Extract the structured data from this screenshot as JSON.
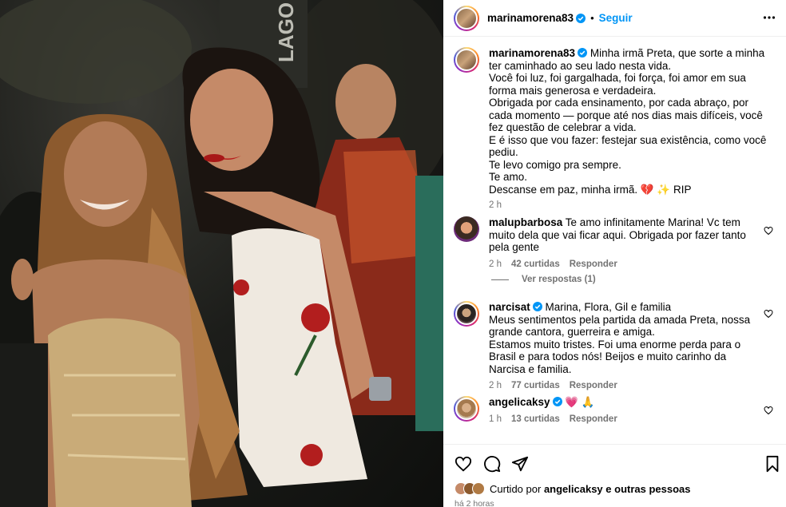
{
  "post": {
    "owner": "marinamorena83",
    "dot": "•",
    "follow_label": "Seguir",
    "caption_lines": [
      "Minha irmã Preta, que sorte a minha ter caminhado ao seu lado nesta vida.",
      "Você foi luz, foi gargalhada, foi força, foi amor em sua forma mais generosa e verdadeira.",
      "Obrigada por cada ensinamento, por cada abraço, por cada momento — porque até nos dias mais difíceis, você fez questão de celebrar a vida.",
      "E é isso que vou fazer: festejar sua existência, como você pediu.",
      "Te levo comigo pra sempre.",
      "Te amo.",
      "Descanse em paz, minha irmã. 💔 ✨ RIP"
    ],
    "caption_time": "2 h"
  },
  "comments": [
    {
      "user": "malupbarbosa",
      "text": "Te amo infinitamente Marina! Vc tem muito dela que vai ficar aqui. Obrigada por fazer tanto pela gente",
      "time": "2 h",
      "likes": "42 curtidas",
      "reply": "Responder",
      "view_replies": "Ver respostas (1)"
    },
    {
      "user": "narcisat",
      "lines": [
        "Marina, Flora, Gil e familia",
        "Meus sentimentos pela partida da amada Preta, nossa grande cantora, guerreira e amiga.",
        "Estamos muito tristes. Foi uma enorme perda para o Brasil e para todos nós! Beijos e muito carinho da Narcisa e familia."
      ],
      "time": "2 h",
      "likes": "77 curtidas",
      "reply": "Responder"
    },
    {
      "user": "angelicaksy",
      "text": "💗 🙏",
      "time": "1 h",
      "likes": "13 curtidas",
      "reply": "Responder"
    }
  ],
  "footer": {
    "liked_prefix": "Curtido por",
    "liked_user": "angelicaksy",
    "liked_suffix": "e outras pessoas",
    "time_ago": "há 2 horas"
  },
  "photo": {
    "sign_text": "LAGO"
  },
  "colors": {
    "accent": "#0095f6",
    "muted": "#737373",
    "border": "#efefef"
  },
  "icons": [
    "verified-badge-icon",
    "more-options-icon",
    "heart-icon",
    "comment-icon",
    "share-icon",
    "save-icon"
  ]
}
